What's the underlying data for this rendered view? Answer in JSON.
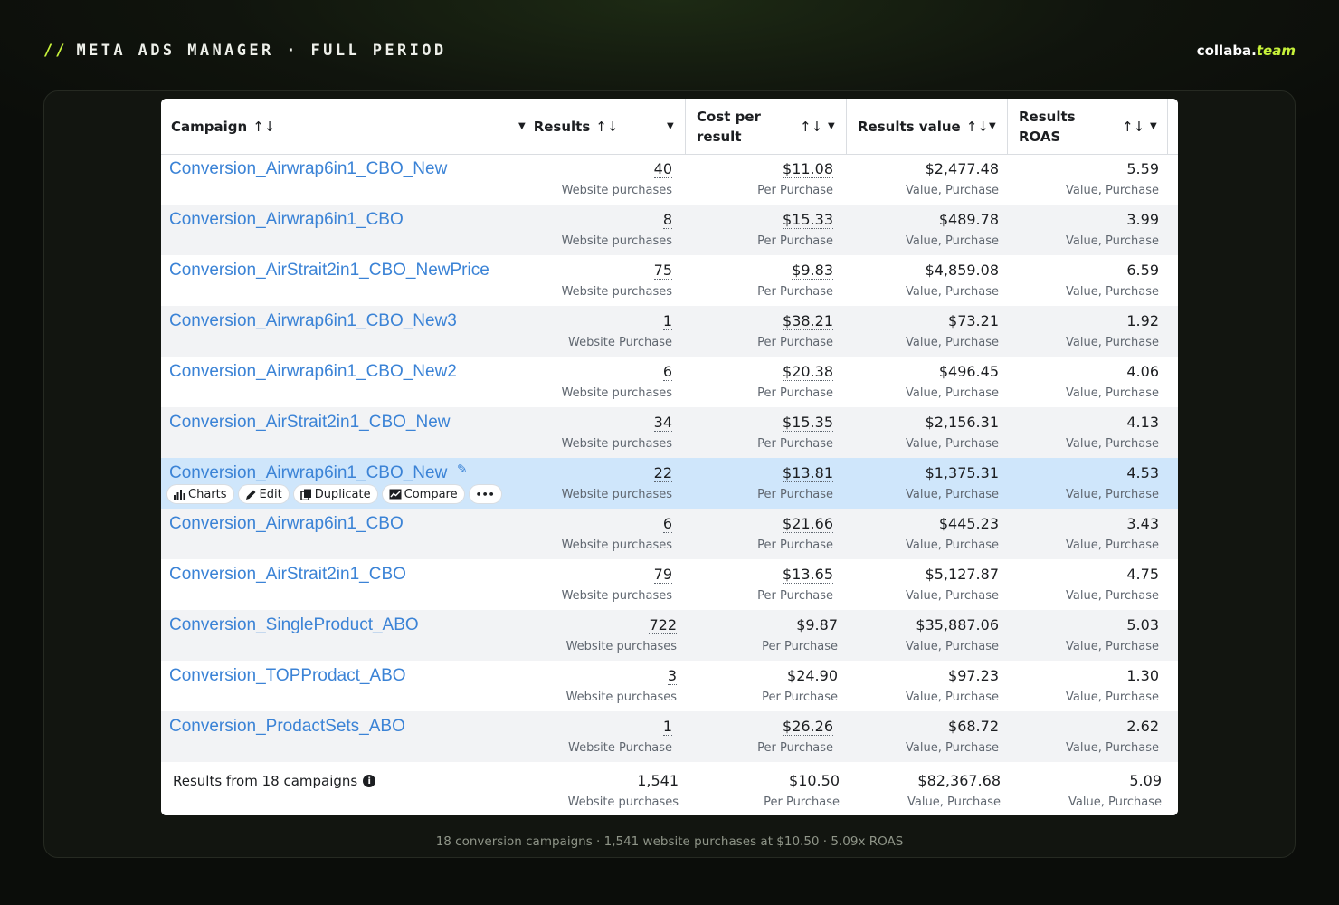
{
  "header": {
    "slashes": "//",
    "title": "META ADS MANAGER · FULL PERIOD",
    "brand_main": "collaba.",
    "brand_tld": "team"
  },
  "table": {
    "columns": [
      {
        "label": "Campaign",
        "sort": "↑↓"
      },
      {
        "label": "Results",
        "sort": "↑↓"
      },
      {
        "label": "Cost per result",
        "sort": "↑↓"
      },
      {
        "label": "Results value",
        "sort": "↑↓"
      },
      {
        "label": "Results ROAS",
        "sort": "↑↓"
      }
    ],
    "rows": [
      {
        "name": "Conversion_Airwrap6in1_CBO_New",
        "results": "40",
        "results_sub": "Website purchases",
        "cost": "$11.08",
        "cost_sub": "Per Purchase",
        "value": "$2,477.48",
        "value_sub": "Value, Purchase",
        "roas": "5.59",
        "roas_sub": "Value, Purchase"
      },
      {
        "name": "Conversion_Airwrap6in1_CBO",
        "results": "8",
        "results_sub": "Website purchases",
        "cost": "$15.33",
        "cost_sub": "Per Purchase",
        "value": "$489.78",
        "value_sub": "Value, Purchase",
        "roas": "3.99",
        "roas_sub": "Value, Purchase"
      },
      {
        "name": "Conversion_AirStrait2in1_CBO_NewPrice",
        "results": "75",
        "results_sub": "Website purchases",
        "cost": "$9.83",
        "cost_sub": "Per Purchase",
        "value": "$4,859.08",
        "value_sub": "Value, Purchase",
        "roas": "6.59",
        "roas_sub": "Value, Purchase"
      },
      {
        "name": "Conversion_Airwrap6in1_CBO_New3",
        "results": "1",
        "results_sub": "Website Purchase",
        "cost": "$38.21",
        "cost_sub": "Per Purchase",
        "value": "$73.21",
        "value_sub": "Value, Purchase",
        "roas": "1.92",
        "roas_sub": "Value, Purchase"
      },
      {
        "name": "Conversion_Airwrap6in1_CBO_New2",
        "results": "6",
        "results_sub": "Website purchases",
        "cost": "$20.38",
        "cost_sub": "Per Purchase",
        "value": "$496.45",
        "value_sub": "Value, Purchase",
        "roas": "4.06",
        "roas_sub": "Value, Purchase"
      },
      {
        "name": "Conversion_AirStrait2in1_CBO_New",
        "results": "34",
        "results_sub": "Website purchases",
        "cost": "$15.35",
        "cost_sub": "Per Purchase",
        "value": "$2,156.31",
        "value_sub": "Value, Purchase",
        "roas": "4.13",
        "roas_sub": "Value, Purchase"
      },
      {
        "name": "Conversion_Airwrap6in1_CBO_New",
        "results": "22",
        "results_sub": "Website purchases",
        "cost": "$13.81",
        "cost_sub": "Per Purchase",
        "value": "$1,375.31",
        "value_sub": "Value, Purchase",
        "roas": "4.53",
        "roas_sub": "Value, Purchase"
      },
      {
        "name": "Conversion_Airwrap6in1_CBO",
        "results": "6",
        "results_sub": "Website purchases",
        "cost": "$21.66",
        "cost_sub": "Per Purchase",
        "value": "$445.23",
        "value_sub": "Value, Purchase",
        "roas": "3.43",
        "roas_sub": "Value, Purchase"
      },
      {
        "name": "Conversion_AirStrait2in1_CBO",
        "results": "79",
        "results_sub": "Website purchases",
        "cost": "$13.65",
        "cost_sub": "Per Purchase",
        "value": "$5,127.87",
        "value_sub": "Value, Purchase",
        "roas": "4.75",
        "roas_sub": "Value, Purchase"
      },
      {
        "name": "Conversion_SingleProduct_ABO",
        "results": "722",
        "results_sub": "Website purchases",
        "cost": "$9.87",
        "cost_sub": "Per Purchase",
        "value": "$35,887.06",
        "value_sub": "Value, Purchase",
        "roas": "5.03",
        "roas_sub": "Value, Purchase"
      },
      {
        "name": "Conversion_TOPProdact_ABO",
        "results": "3",
        "results_sub": "Website purchases",
        "cost": "$24.90",
        "cost_sub": "Per Purchase",
        "value": "$97.23",
        "value_sub": "Value, Purchase",
        "roas": "1.30",
        "roas_sub": "Value, Purchase"
      },
      {
        "name": "Conversion_ProdactSets_ABO",
        "results": "1",
        "results_sub": "Website Purchase",
        "cost": "$26.26",
        "cost_sub": "Per Purchase",
        "value": "$68.72",
        "value_sub": "Value, Purchase",
        "roas": "2.62",
        "roas_sub": "Value, Purchase"
      }
    ],
    "row_actions": {
      "charts": "Charts",
      "edit": "Edit",
      "duplicate": "Duplicate",
      "compare": "Compare",
      "more": "•••"
    },
    "footer": {
      "label": "Results from 18 campaigns",
      "info": "i",
      "results": "1,541",
      "results_sub": "Website purchases",
      "cost": "$10.50",
      "cost_sub": "Per Purchase",
      "value": "$82,367.68",
      "value_sub": "Value, Purchase",
      "roas": "5.09",
      "roas_sub": "Value, Purchase"
    }
  },
  "caption": "18 conversion campaigns · 1,541 website purchases at $10.50 · 5.09x ROAS"
}
